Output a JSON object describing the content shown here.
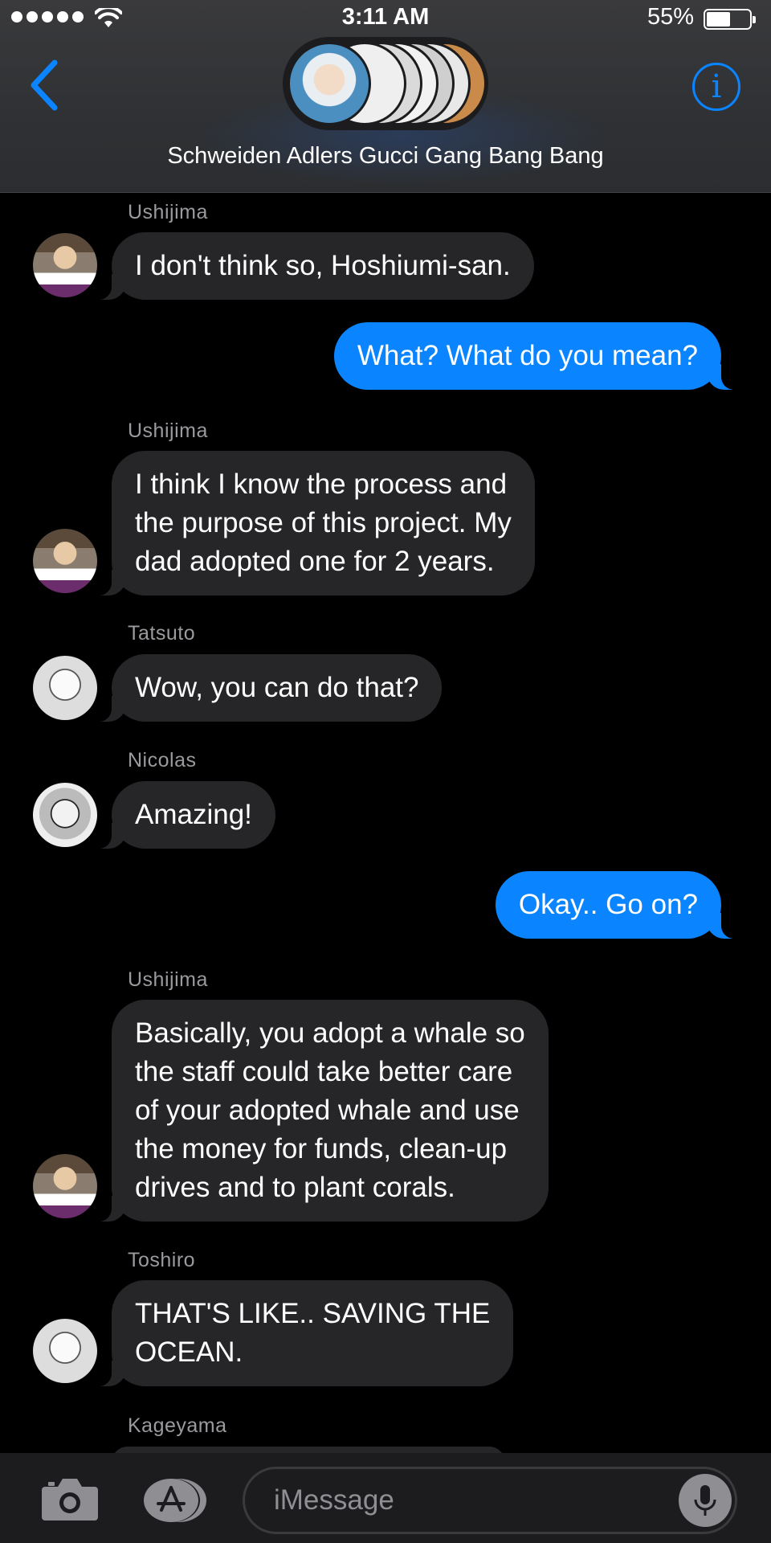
{
  "status_bar": {
    "time": "3:11 AM",
    "battery_percent": "55%",
    "battery_level": 0.55,
    "signal_bars": 5
  },
  "header": {
    "group_title": "Schweiden Adlers Gucci Gang Bang Bang",
    "back_icon": "chevron-left-icon",
    "info_icon": "info-circle-icon"
  },
  "messages": [
    {
      "sender": "Ushijima",
      "direction": "incoming",
      "text": "I don't think so, Hoshiumi-san."
    },
    {
      "direction": "outgoing",
      "text": "What? What do you mean?"
    },
    {
      "sender": "Ushijima",
      "direction": "incoming",
      "text": "I think I know the process and\nthe purpose of this project. My\ndad adopted one for 2 years."
    },
    {
      "sender": "Tatsuto",
      "direction": "incoming",
      "text": "Wow, you can do that?"
    },
    {
      "sender": "Nicolas",
      "direction": "incoming",
      "text": "Amazing!"
    },
    {
      "direction": "outgoing",
      "text": "Okay.. Go on?"
    },
    {
      "sender": "Ushijima",
      "direction": "incoming",
      "text": "Basically, you adopt a whale so\nthe staff could take better care\nof your adopted whale and use\nthe money for funds, clean-up\ndrives and to plant corals."
    },
    {
      "sender": "Toshiro",
      "direction": "incoming",
      "text": "THAT'S LIKE.. SAVING THE\nOCEAN."
    },
    {
      "sender": "Kageyama",
      "direction": "incoming",
      "text": ""
    }
  ],
  "input_bar": {
    "placeholder": "iMessage",
    "camera_icon": "camera-icon",
    "apps_icon": "app-store-icon",
    "mic_icon": "microphone-icon"
  },
  "colors": {
    "outgoing_bubble": "#0a84ff",
    "incoming_bubble": "#262628",
    "background": "#000000",
    "accent": "#0a84ff"
  }
}
